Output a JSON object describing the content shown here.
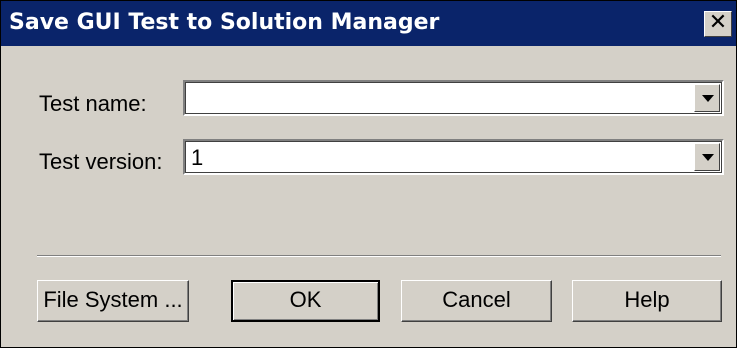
{
  "window": {
    "title": "Save GUI Test to Solution Manager",
    "close_glyph": "✕"
  },
  "form": {
    "test_name_label": "Test name:",
    "test_name_value": "",
    "test_version_label": "Test version:",
    "test_version_value": "1"
  },
  "buttons": {
    "file_system": "File System ...",
    "ok": "OK",
    "cancel": "Cancel",
    "help": "Help"
  },
  "icons": {
    "close": "close-icon",
    "dropdown": "chevron-down-icon"
  },
  "colors": {
    "titlebar": "#0a246a",
    "face": "#d4d0c8"
  }
}
